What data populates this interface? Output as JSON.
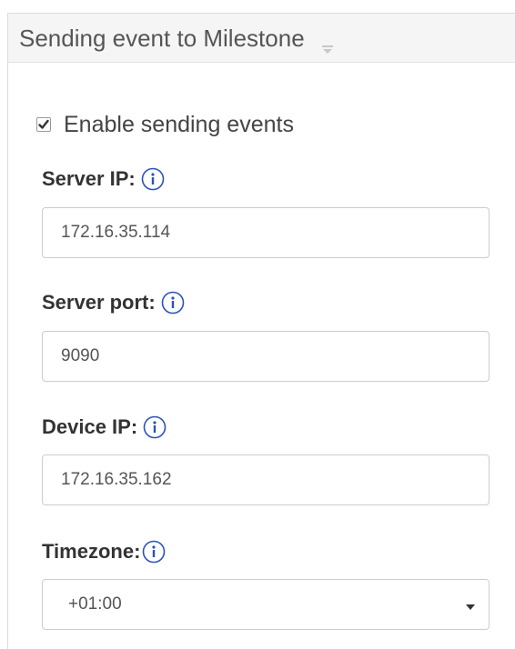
{
  "section": {
    "title": "Sending event to Milestone",
    "collapse_icon": "caret-down-icon"
  },
  "enable_sending": {
    "label": "Enable sending events",
    "checked": true
  },
  "server_ip": {
    "label": "Server IP:",
    "value": "172.16.35.114",
    "info_icon": "info-icon"
  },
  "server_port": {
    "label": "Server port:",
    "value": "9090",
    "info_icon": "info-icon"
  },
  "device_ip": {
    "label": "Device IP:",
    "value": "172.16.35.162",
    "info_icon": "info-icon"
  },
  "timezone": {
    "label": "Timezone:",
    "value": "+01:00",
    "info_icon": "info-icon",
    "dropdown_icon": "dropdown-arrow-icon"
  },
  "colors": {
    "info_icon": "#2a52be",
    "border": "#cccccc",
    "header_bg": "#f5f5f5"
  }
}
